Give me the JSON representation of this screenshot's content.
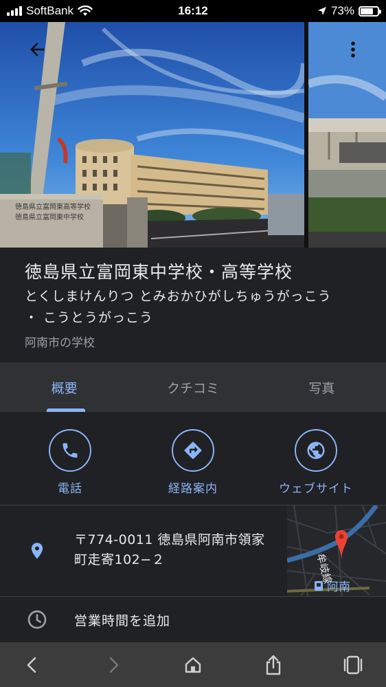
{
  "status_bar": {
    "carrier": "SoftBank",
    "time": "16:12",
    "battery": "73%",
    "battery_level": 0.73
  },
  "place": {
    "name": "徳島県立富岡東中学校・高等学校",
    "reading_line1": "とくしまけんりつ とみおかひがしちゅうがっこう",
    "reading_line2": "・ こうとうがっこう",
    "category": "阿南市の学校"
  },
  "tabs": [
    {
      "label": "概要",
      "active": true
    },
    {
      "label": "クチコミ",
      "active": false
    },
    {
      "label": "写真",
      "active": false
    }
  ],
  "actions": {
    "call": "電話",
    "directions": "経路案内",
    "website": "ウェブサイト"
  },
  "address": {
    "line1": "〒774-0011 徳島県阿南市領家",
    "line2": "町走寄102−２"
  },
  "minimap": {
    "rail_label": "牟岐線",
    "station_label": "阿南"
  },
  "hours": {
    "label": "営業時間を追加"
  },
  "photo_sign": {
    "line1": "徳島県立富岡東高等学校",
    "line2": "徳島県立富岡東中学校"
  },
  "colors": {
    "accent": "#8ab4f8",
    "background": "#202124",
    "tab_background": "#303134",
    "map_pin": "#ea4335"
  },
  "icons": {
    "back": "arrow-left-icon",
    "more": "more-vert-icon",
    "call": "phone-icon",
    "directions": "directions-icon",
    "website": "globe-icon",
    "location": "location-pin-icon",
    "hours": "clock-icon"
  }
}
